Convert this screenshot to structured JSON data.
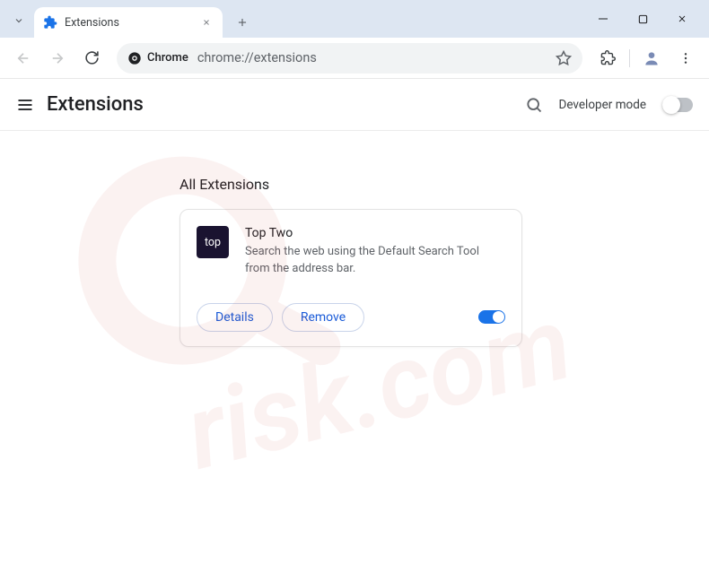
{
  "tab": {
    "title": "Extensions"
  },
  "omnibox": {
    "chip": "Chrome",
    "url": "chrome://extensions"
  },
  "header": {
    "title": "Extensions",
    "dev_mode_label": "Developer mode"
  },
  "section": {
    "title": "All Extensions"
  },
  "extension": {
    "name": "Top Two",
    "description": "Search the web using the Default Search Tool from the address bar.",
    "icon_text": "top",
    "details_label": "Details",
    "remove_label": "Remove",
    "enabled": true
  },
  "watermark": {
    "text": "risk.com"
  }
}
